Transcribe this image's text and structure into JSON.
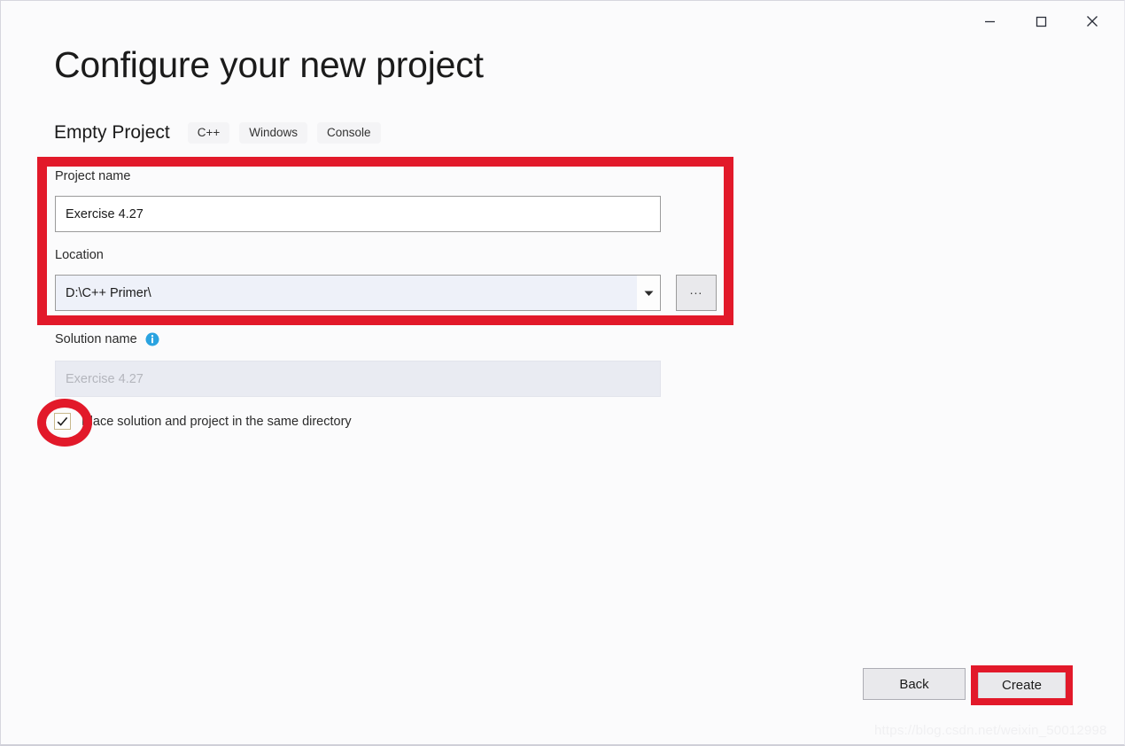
{
  "window": {
    "controls": {
      "minimize": "minimize-icon",
      "maximize": "maximize-icon",
      "close": "close-icon"
    }
  },
  "header": {
    "title": "Configure your new project",
    "template_name": "Empty Project",
    "tags": [
      "C++",
      "Windows",
      "Console"
    ]
  },
  "form": {
    "project_name": {
      "label": "Project name",
      "value": "Exercise 4.27"
    },
    "location": {
      "label": "Location",
      "value": "D:\\C++ Primer\\",
      "dropdown_icon": "chevron-down-icon",
      "browse_label": "..."
    },
    "solution_name": {
      "label": "Solution name",
      "info_icon": "info-icon",
      "placeholder": "Exercise 4.27",
      "value": ""
    },
    "same_directory_checkbox": {
      "label": "Place solution and project in the same directory",
      "checked": true,
      "check_glyph": "✓"
    }
  },
  "footer": {
    "back_label": "Back",
    "create_label": "Create"
  },
  "annotations": {
    "color": "#e2192a",
    "highlight_fields_rect": "project-name-and-location",
    "highlight_checkbox_ellipse": "same-directory-checkbox",
    "highlight_create_rect": "create-button"
  },
  "watermark": {
    "text": "https://blog.csdn.net/weixin_50012998"
  }
}
